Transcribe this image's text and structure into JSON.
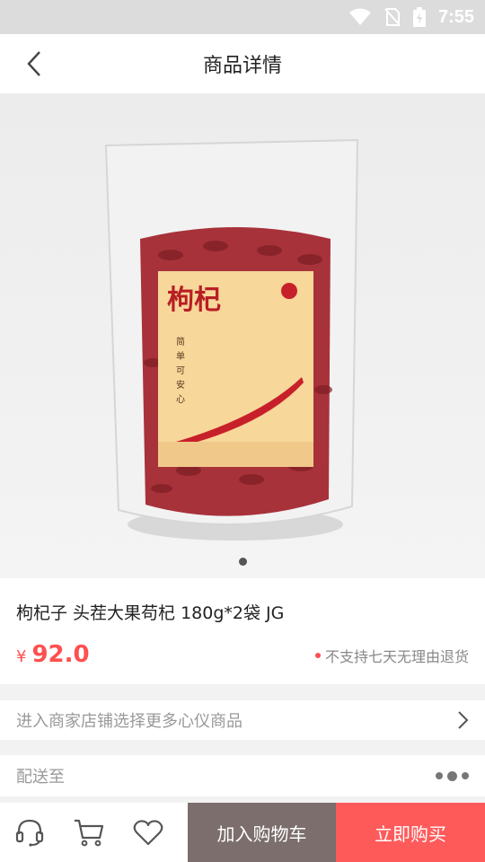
{
  "status": {
    "time": "7:55"
  },
  "nav": {
    "title": "商品详情"
  },
  "product": {
    "image_label": "枸杞",
    "image_sub1": "简",
    "image_sub2": "单",
    "image_sub3": "可",
    "image_sub4": "安",
    "image_sub5": "心",
    "name": "枸杞子 头茬大果苟杞 180g*2袋 JG",
    "price_symbol": "¥",
    "price": "92.0",
    "return_notice": "不支持七天无理由退货"
  },
  "store_row": {
    "label": "进入商家店铺选择更多心仪商品"
  },
  "shipping_row": {
    "label": "配送至"
  },
  "bottom": {
    "add_to_cart": "加入购物车",
    "buy_now": "立即购买"
  },
  "colors": {
    "accent": "#ff5a5a",
    "price": "#ff4f4f",
    "cart_button": "#7b6e6c"
  }
}
